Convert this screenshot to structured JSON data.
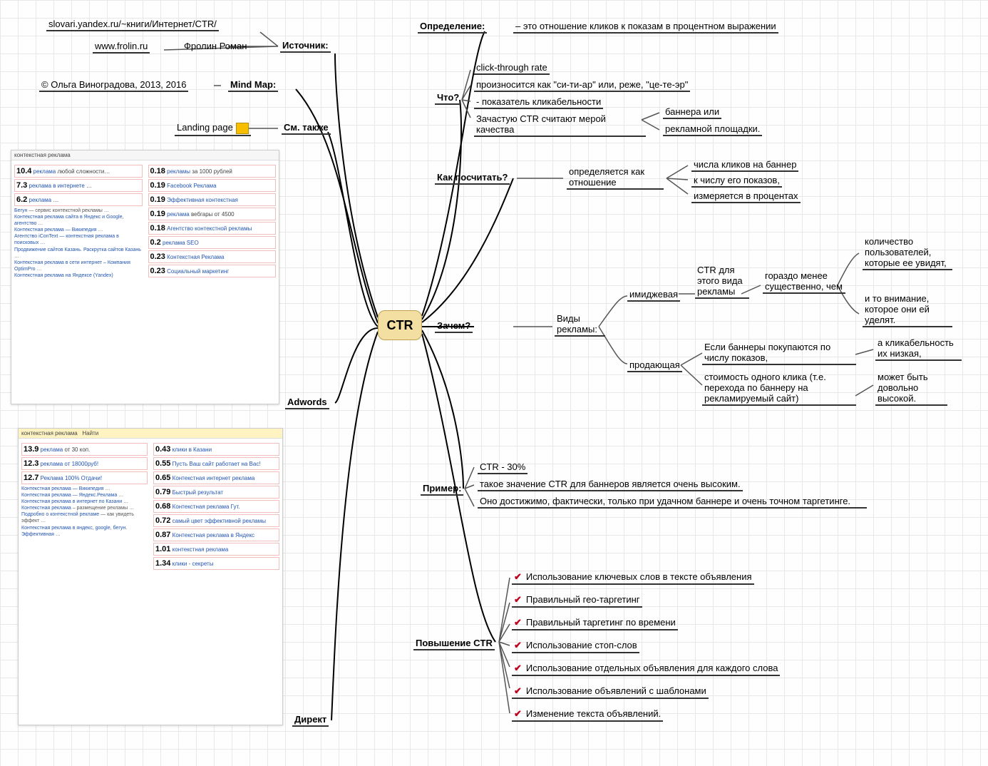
{
  "center": "CTR",
  "left": {
    "source": {
      "label": "Источник:",
      "url": "slovari.yandex.ru/~книги/Интернет/CTR/",
      "site": "www.frolin.ru",
      "author": "Фролин Роман"
    },
    "mindmap": {
      "label": "Mind Map:",
      "credit": "© Ольга Виноградова, 2013, 2016"
    },
    "seealso": {
      "label": "См. также",
      "item": "Landing page"
    },
    "adwords": {
      "label": "Adwords"
    },
    "direct": {
      "label": "Директ"
    }
  },
  "right": {
    "def": {
      "label": "Определение:",
      "text": "– это отношение кликов к показам в процентном выражении"
    },
    "what": {
      "label": "Что?",
      "items": [
        "click-through rate",
        "произносится как \"си-ти-ар\" или, реже, \"це-те-эр\"",
        "- показатель кликабельности"
      ],
      "quality": "Зачастую CTR считают мерой качества",
      "quality_sub": [
        "баннера или",
        "рекламной площадки."
      ]
    },
    "howto": {
      "label": "Как посчитать?",
      "lead": "определяется как отношение",
      "items": [
        "числа кликов на баннер",
        "к числу его показов,",
        "измеряется в процентах"
      ]
    },
    "why": {
      "label": "Зачем?",
      "kinds": "Виды рекламы:",
      "image": {
        "name": "имиджевая",
        "ctr": "CTR для этого вида рекламы",
        "less": "гораздо менее существенно, чем",
        "cons": [
          "количество пользователей, которые ее увидят,",
          "и то внимание, которое они ей уделят."
        ]
      },
      "sell": {
        "name": "продающая",
        "ifbuy": "Если баннеры покупаются по числу показов,",
        "low": "а кликабельность их низкая,",
        "cost": "стоимость одного клика (т.е. перехода по баннеру на рекламируемый сайт)",
        "high": "может быть довольно высокой."
      }
    },
    "primer": {
      "label": "Пример:",
      "items": [
        "CTR - 30%",
        "такое значение CTR для баннеров является очень высоким.",
        "Оно достижимо, фактически, только при удачном баннере и очень точном таргетинге."
      ]
    },
    "improve": {
      "label": "Повышение CTR",
      "items": [
        "Использование ключевых слов в тексте объявления",
        "Правильный гео-таргетинг",
        "Правильный таргетинг по времени",
        "Использование стоп-слов",
        "Использование отдельных объявления для каждого слова",
        "Использование объявлений с шаблонами",
        "Изменение текста объявлений."
      ]
    }
  },
  "shots": {
    "search_term": "контекстная реклама",
    "a_left": [
      "10.4",
      "7.3",
      "6.2"
    ],
    "a_right": [
      "0.18",
      "0.19",
      "0.19",
      "0.19",
      "0.18",
      "0.2",
      "0.23",
      "0.23"
    ],
    "d_left": [
      "13.9",
      "12.3",
      "12.7"
    ],
    "d_right": [
      "0.43",
      "0.55",
      "0.65",
      "0.79",
      "0.68",
      "0.72",
      "0.87",
      "1.01",
      "1.34"
    ]
  }
}
